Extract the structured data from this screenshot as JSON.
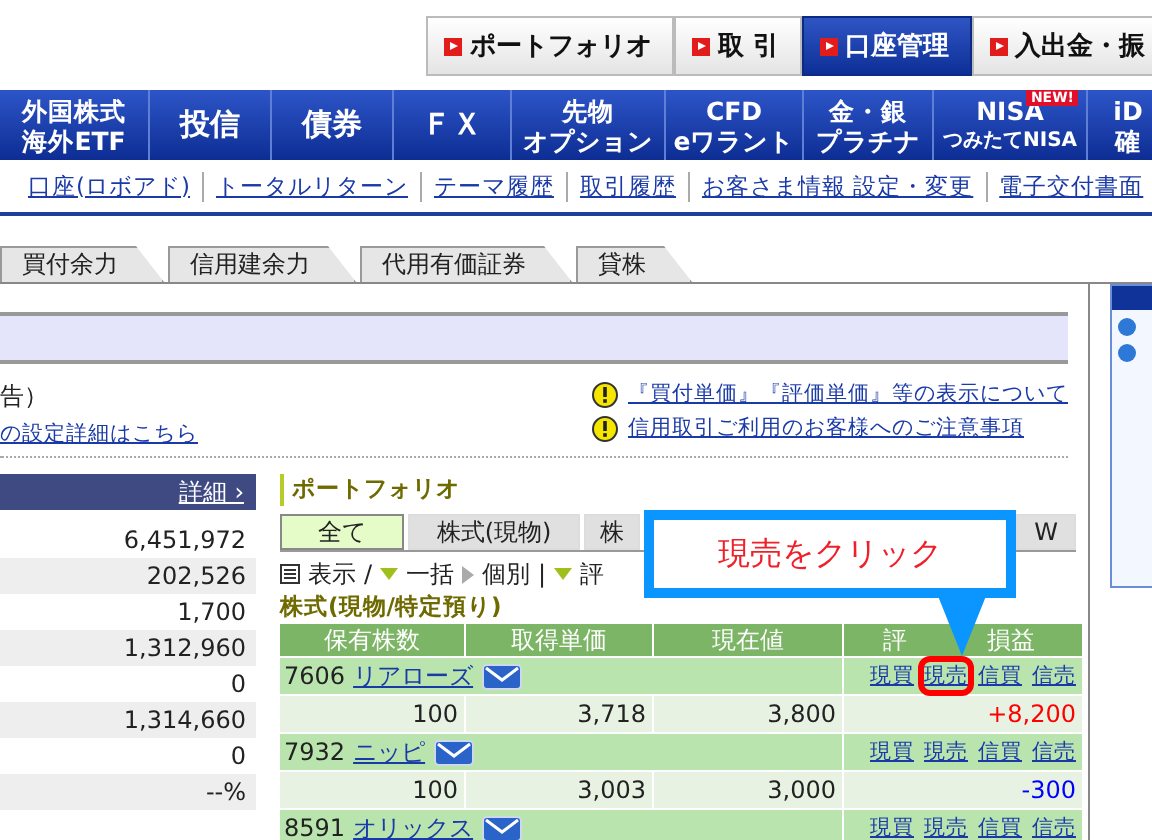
{
  "top_buttons": [
    {
      "label": "ポートフォリオ",
      "selected": false
    },
    {
      "label": "取 引",
      "selected": false
    },
    {
      "label": "口座管理",
      "selected": true
    },
    {
      "label": "入出金・振",
      "selected": false
    }
  ],
  "main_nav": [
    {
      "lines": [
        "外国株式",
        "海外ETF"
      ]
    },
    {
      "lines": [
        "投信"
      ]
    },
    {
      "lines": [
        "債券"
      ]
    },
    {
      "lines": [
        "ＦＸ"
      ]
    },
    {
      "lines": [
        "先物",
        "オプション"
      ]
    },
    {
      "lines": [
        "CFD",
        "eワラント"
      ]
    },
    {
      "lines": [
        "金・銀",
        "プラチナ"
      ]
    },
    {
      "lines": [
        "NISA",
        "つみたてNISA"
      ],
      "badge": "NEW!"
    },
    {
      "lines": [
        "iD",
        "確"
      ]
    }
  ],
  "sub_nav": [
    "口座(ロボアド)",
    "トータルリターン",
    "テーマ履歴",
    "取引履歴",
    "お客さま情報 設定・変更",
    "電子交付書面"
  ],
  "account_tabs": [
    {
      "label": "買付余力",
      "selected": false
    },
    {
      "label": "信用建余力",
      "selected": false
    },
    {
      "label": "代用有価証券",
      "selected": false
    },
    {
      "label": "貸株",
      "selected": false
    }
  ],
  "notice_text": "告）",
  "notice_link": "の設定詳細はこちら",
  "warning_links": [
    "『買付単価』『評価単価』等の表示について",
    "信用取引ご利用のお客様へのご注意事項"
  ],
  "summary": {
    "detail_link": "詳細 ›",
    "values": [
      "6,451,972",
      "202,526",
      "1,700",
      "1,312,960",
      "0",
      "1,314,660",
      "0",
      "--%"
    ]
  },
  "portfolio": {
    "title": "ポートフォリオ",
    "tabs": [
      {
        "label": "全て",
        "selected": true
      },
      {
        "label": "株式(現物)",
        "selected": false
      },
      {
        "label": "株",
        "selected": false
      },
      {
        "label": "W",
        "selected": false
      }
    ],
    "toolbar": [
      {
        "kind": "list",
        "label": "表示"
      },
      {
        "kind": "separator",
        "label": "/"
      },
      {
        "kind": "down",
        "label": "一括"
      },
      {
        "kind": "right",
        "label": "個別"
      },
      {
        "kind": "separator",
        "label": "|"
      },
      {
        "kind": "down",
        "label": "評"
      }
    ],
    "section_title": "株式(現物/特定預り)",
    "columns": [
      "保有株数",
      "取得単価",
      "現在値"
    ],
    "profit_column": [
      "評",
      "損益"
    ],
    "holdings": [
      {
        "code": "7606",
        "name": "リアローズ",
        "shares": "100",
        "cost": "3,718",
        "price": "3,800",
        "profit": "+8,200",
        "color": "#ff0000",
        "actions": [
          {
            "label": "現買",
            "highlighted": false
          },
          {
            "label": "現売",
            "highlighted": true
          },
          {
            "label": "信買",
            "highlighted": false
          },
          {
            "label": "信売",
            "highlighted": false
          }
        ]
      },
      {
        "code": "7932",
        "name": "ニッピ",
        "shares": "100",
        "cost": "3,003",
        "price": "3,000",
        "profit": "-300",
        "color": "#0000ff",
        "actions": [
          {
            "label": "現買",
            "highlighted": false
          },
          {
            "label": "現売",
            "highlighted": false
          },
          {
            "label": "信買",
            "highlighted": false
          },
          {
            "label": "信売",
            "highlighted": false
          }
        ]
      },
      {
        "code": "8591",
        "name": "オリックス",
        "actions": [
          {
            "label": "現買",
            "highlighted": false
          },
          {
            "label": "現売",
            "highlighted": false
          },
          {
            "label": "信買",
            "highlighted": false
          },
          {
            "label": "信売",
            "highlighted": false
          }
        ]
      }
    ]
  },
  "callout": {
    "text": "現売をクリック"
  }
}
